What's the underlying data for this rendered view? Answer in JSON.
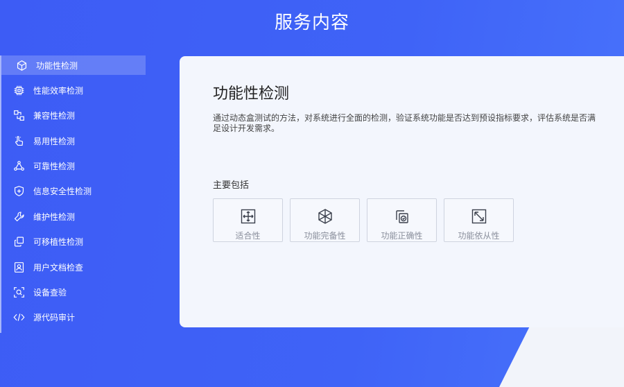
{
  "header": {
    "title": "服务内容"
  },
  "sidebar": {
    "items": [
      {
        "label": "功能性检测",
        "icon": "cube-icon",
        "active": true
      },
      {
        "label": "性能效率检测",
        "icon": "chip-icon"
      },
      {
        "label": "兼容性检测",
        "icon": "connect-icon"
      },
      {
        "label": "易用性检测",
        "icon": "pointer-hand-icon"
      },
      {
        "label": "可靠性检测",
        "icon": "network-triangle-icon"
      },
      {
        "label": "信息安全性检测",
        "icon": "shield-plus-icon"
      },
      {
        "label": "维护性检测",
        "icon": "wrench-icon"
      },
      {
        "label": "可移植性检测",
        "icon": "copy-icon"
      },
      {
        "label": "用户文档检查",
        "icon": "user-document-icon"
      },
      {
        "label": "设备查验",
        "icon": "scan-search-icon"
      },
      {
        "label": "源代码审计",
        "icon": "code-icon"
      }
    ]
  },
  "main": {
    "title": "功能性检测",
    "description": "通过动态盒测试的方法，对系统进行全面的检测，验证系统功能是否达到预设指标要求，评估系统是否满足设计开发需求。",
    "includes_label": "主要包括",
    "features": [
      {
        "label": "适合性",
        "icon": "expand-arrows-icon"
      },
      {
        "label": "功能完备性",
        "icon": "hexagon-network-icon"
      },
      {
        "label": "功能正确性",
        "icon": "copy-check-icon"
      },
      {
        "label": "功能依从性",
        "icon": "resize-diagonal-icon"
      }
    ]
  },
  "colors": {
    "background": "#3f5ff6",
    "card": "#f3f6fd",
    "active_item": "rgba(255,255,255,0.2)"
  }
}
